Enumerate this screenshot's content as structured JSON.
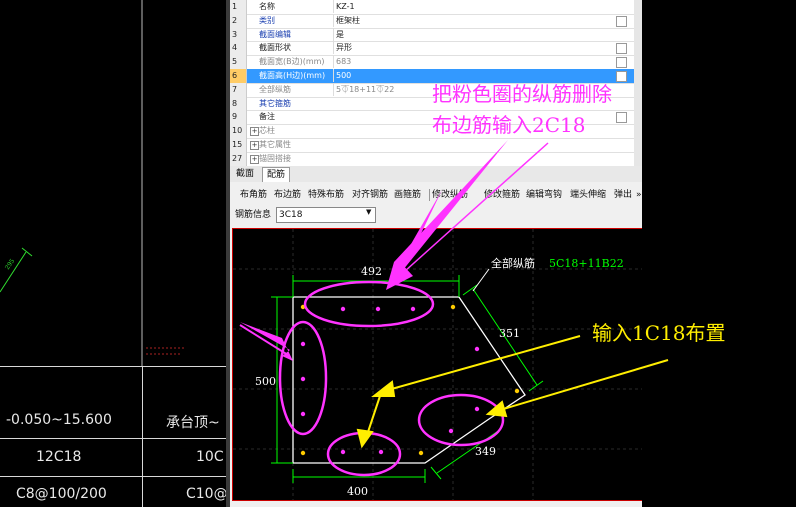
{
  "cad": {
    "dim_label": "295",
    "col1": [
      "-0.050~15.600",
      "12C18",
      "C8@100/200"
    ],
    "col2": [
      "承台顶~",
      "10C",
      "C10@"
    ]
  },
  "properties": {
    "rows": [
      {
        "num": "1",
        "name": "名称",
        "value": "KZ-1",
        "name_style": "black",
        "checkbox": false
      },
      {
        "num": "2",
        "name": "类别",
        "value": "框架柱",
        "name_style": "blue",
        "checkbox": true
      },
      {
        "num": "3",
        "name": "截面编辑",
        "value": "是",
        "name_style": "blue",
        "checkbox": false
      },
      {
        "num": "4",
        "name": "截面形状",
        "value": "异形",
        "name_style": "black",
        "checkbox": true
      },
      {
        "num": "5",
        "name": "截面宽(B边)(mm)",
        "value": "683",
        "name_style": "gray",
        "checkbox": true
      },
      {
        "num": "6",
        "name": "截面高(H边)(mm)",
        "value": "500",
        "name_style": "gray",
        "checkbox": true,
        "selected": true
      },
      {
        "num": "7",
        "name": "全部纵筋",
        "value": "5⏁18+11⏁22",
        "name_style": "gray",
        "checkbox": false
      },
      {
        "num": "8",
        "name": "其它箍筋",
        "value": "",
        "name_style": "blue",
        "checkbox": false
      },
      {
        "num": "9",
        "name": "备注",
        "value": "",
        "name_style": "black",
        "checkbox": true
      },
      {
        "num": "10",
        "name": "芯柱",
        "value": "",
        "name_style": "gray",
        "expand": true
      },
      {
        "num": "15",
        "name": "其它属性",
        "value": "",
        "name_style": "gray",
        "expand": true
      },
      {
        "num": "27",
        "name": "锚固搭接",
        "value": "",
        "name_style": "gray",
        "expand": true
      }
    ]
  },
  "tabs": [
    "截面",
    "配筋"
  ],
  "toolbar": [
    "布角筋",
    "布边筋",
    "特殊布筋",
    "对齐钢筋",
    "画箍筋",
    "修改纵筋",
    "修改箍筋",
    "编辑弯钩",
    "端头伸缩",
    "弹出",
    "»"
  ],
  "rebar_info": {
    "label": "钢筋信息",
    "value": "3C18"
  },
  "section": {
    "top_dim": "492",
    "right_dim": "351",
    "left_dim": "500",
    "bottom_dim": "400",
    "corner_dim": "349",
    "total_label": "全部纵筋",
    "total_value": "5C18+11B22"
  },
  "annotations": {
    "pink_line1": "把粉色圈的纵筋删除",
    "pink_line2": "布边筋输入2C18",
    "yellow": "输入1C18布置"
  },
  "colors": {
    "pink": "#ff33ff",
    "yellow": "#ffee00",
    "green": "#00ff00",
    "selected_row": "#3399ff"
  }
}
